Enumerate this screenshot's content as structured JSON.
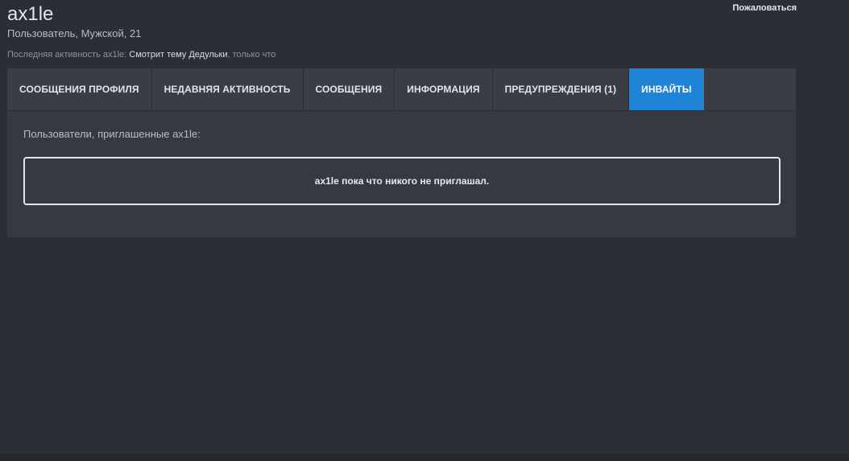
{
  "header": {
    "username": "ax1le",
    "meta": "Пользователь, Мужской, 21",
    "report_label": "Пожаловаться",
    "activity_prefix": "Последняя активность ax1le:",
    "activity_action": "Смотрит тему",
    "activity_thread": "Дедульки",
    "activity_time": "только что"
  },
  "tabs": [
    {
      "label": "СООБЩЕНИЯ ПРОФИЛЯ"
    },
    {
      "label": "НЕДАВНЯЯ АКТИВНОСТЬ"
    },
    {
      "label": "СООБЩЕНИЯ"
    },
    {
      "label": "ИНФОРМАЦИЯ"
    },
    {
      "label": "ПРЕДУПРЕЖДЕНИЯ (1)"
    },
    {
      "label": "ИНВАЙТЫ"
    }
  ],
  "invites": {
    "section_label": "Пользователи, приглашенные ax1le:",
    "empty_message": "ax1le пока что никого не приглашал."
  },
  "colors": {
    "background": "#2b2e35",
    "panel": "#363940",
    "active_tab": "#1f84d6"
  }
}
